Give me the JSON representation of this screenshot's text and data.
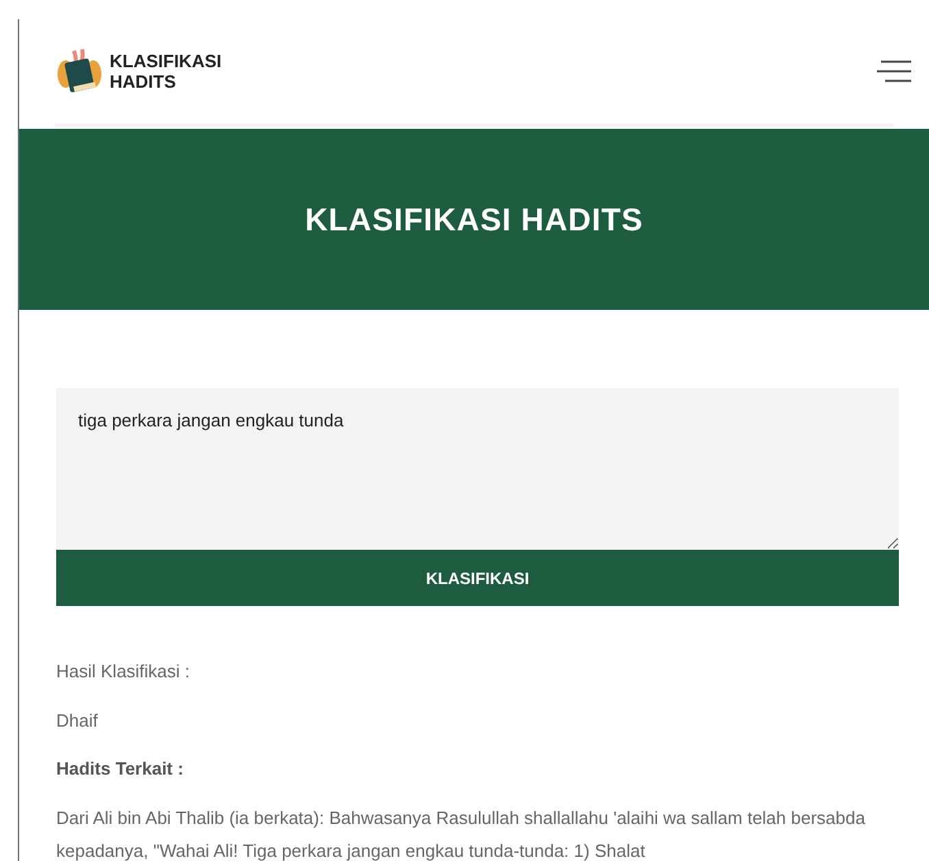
{
  "header": {
    "logo_text": [
      "KLASIFIKASI",
      "HADITS"
    ]
  },
  "banner": {
    "title": "KLASIFIKASI HADITS"
  },
  "query": {
    "value": "tiga perkara jangan engkau tunda"
  },
  "submit_button": "KLASIFIKASI",
  "result": {
    "label": "Hasil Klasifikasi :",
    "value": "Dhaif",
    "related_heading": "Hadits Terkait :",
    "related_text": "Dari Ali bin Abi Thalib (ia berkata): Bahwasanya Rasulullah shallallahu 'alaihi wa sallam telah bersabda kepadanya, \"Wahai Ali! Tiga perkara jangan engkau tunda-tunda: 1) Shalat"
  }
}
